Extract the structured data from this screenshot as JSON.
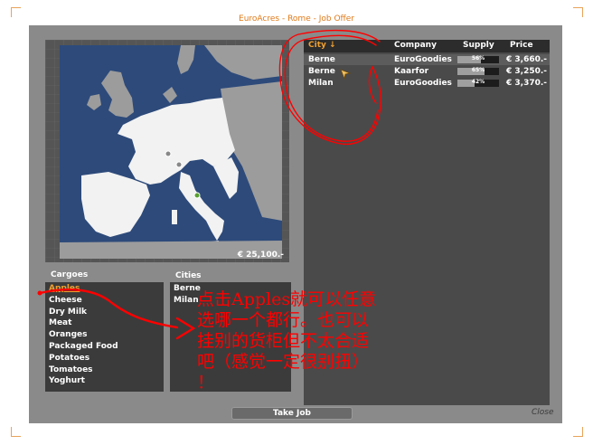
{
  "window_title": "EuroAcres - Rome - Job Offer",
  "map": {
    "price": "€ 25,100.-"
  },
  "offers": {
    "columns": {
      "city": "City ↓",
      "company": "Company",
      "supply": "Supply",
      "price": "Price"
    },
    "rows": [
      {
        "city": "Berne",
        "company": "EuroGoodies",
        "supply_pct": 56,
        "supply_label": "56%",
        "price": "€ 3,660.-"
      },
      {
        "city": "Berne",
        "company": "Kaarfor",
        "supply_pct": 65,
        "supply_label": "65%",
        "price": "€ 3,250.-"
      },
      {
        "city": "Milan",
        "company": "EuroGoodies",
        "supply_pct": 42,
        "supply_label": "42%",
        "price": "€ 3,370.-"
      }
    ]
  },
  "cargoes": {
    "title": "Cargoes",
    "items": [
      "Apples",
      "Cheese",
      "Dry Milk",
      "Meat",
      "Oranges",
      "Packaged Food",
      "Potatoes",
      "Tomatoes",
      "Yoghurt"
    ]
  },
  "cities": {
    "title": "Cities",
    "items": [
      "Berne",
      "Milan"
    ]
  },
  "buttons": {
    "take_job": "Take Job",
    "close": "Close"
  },
  "annotation": {
    "lines": [
      "点击Apples就可以任意",
      "选哪一个都行。也可以",
      "挂别的货柜但不太合适",
      "吧（感觉一定很别扭）",
      "！"
    ]
  },
  "colors": {
    "accent": "#e07a18",
    "selected": "#f0a030",
    "annotation": "#ff0000",
    "sea": "#2d4a7a",
    "land": "#f2f2f2"
  }
}
